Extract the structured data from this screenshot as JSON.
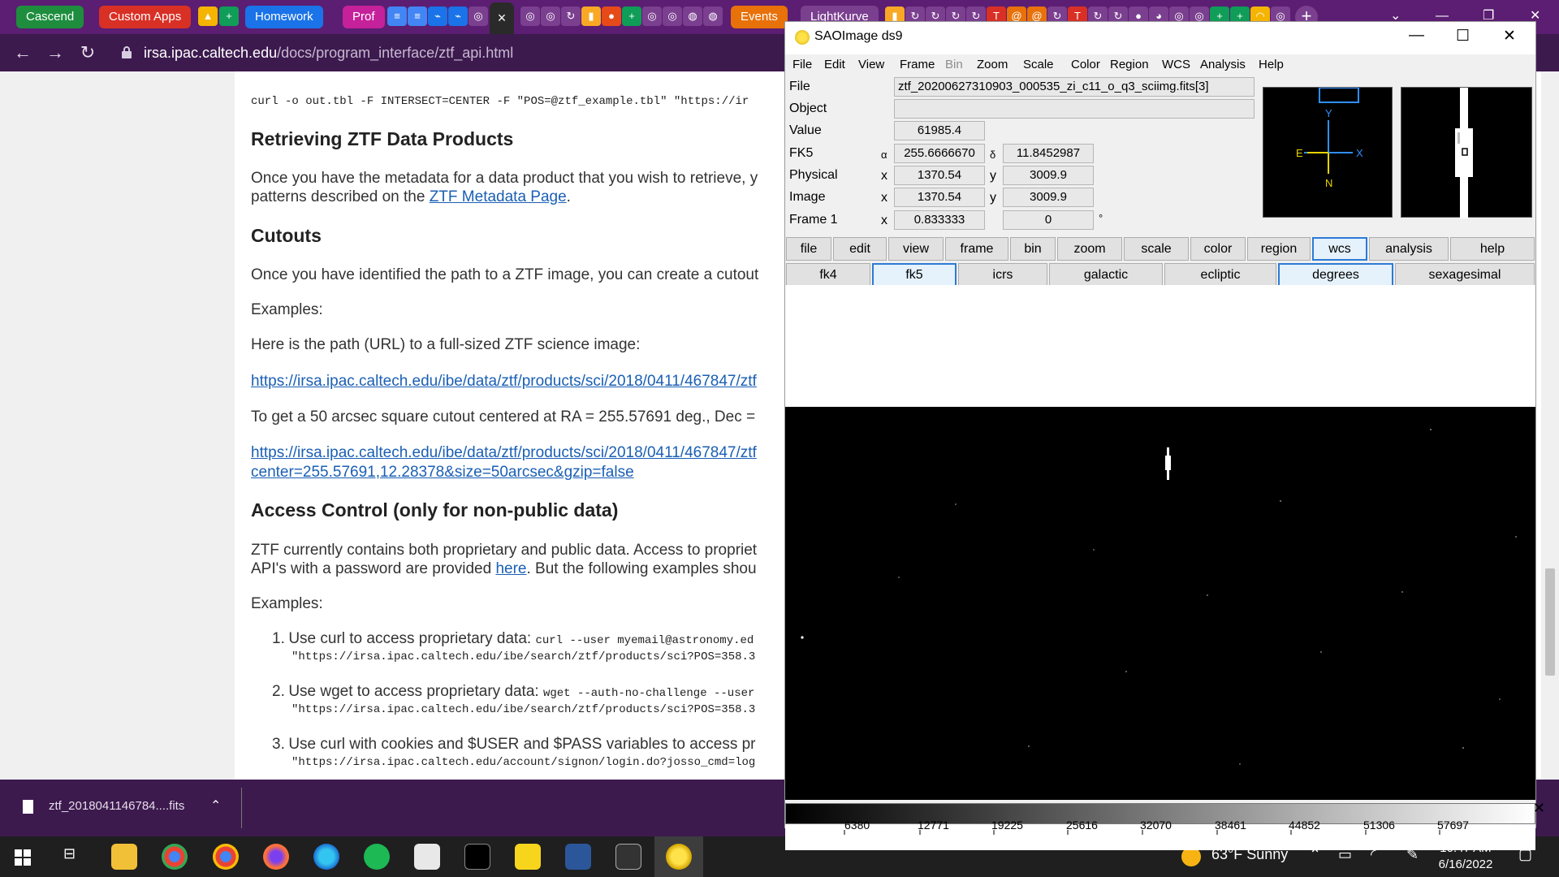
{
  "browser": {
    "tab_groups": [
      {
        "label": "Cascend",
        "color": "#1e8e3e"
      },
      {
        "label": "Custom Apps",
        "color": "#d93025"
      },
      {
        "label": "Homework",
        "color": "#1a73e8"
      },
      {
        "label": "Prof",
        "color": "#c5219b"
      },
      {
        "label": "Events",
        "color": "#e8710a"
      }
    ],
    "active_tab_close": "×",
    "lightkurve_tab": "LightKurve",
    "address_domain": "irsa.ipac.caltech.edu",
    "address_path": "/docs/program_interface/ztf_api.html"
  },
  "article": {
    "top_code": "curl -o out.tbl -F INTERSECT=CENTER -F \"POS=@ztf_example.tbl\" \"https://ir",
    "h_retrieving": "Retrieving ZTF Data Products",
    "p_retrieving_1": "Once you have the metadata for a data product that you wish to retrieve, y",
    "p_retrieving_2a": "patterns described on the ",
    "p_retrieving_link": "ZTF Metadata Page",
    "p_retrieving_2b": ".",
    "h_cutouts": "Cutouts",
    "p_cutouts": "Once you have identified the path to a ZTF image, you can create a cutout",
    "examples_1": "Examples:",
    "p_path": "Here is the path (URL) to a full-sized ZTF science image:",
    "link_path": "https://irsa.ipac.caltech.edu/ibe/data/ztf/products/sci/2018/0411/467847/ztf",
    "p_cutout_desc": "To get a 50 arcsec square cutout centered at RA = 255.57691 deg., Dec =",
    "link_cutout_1": "https://irsa.ipac.caltech.edu/ibe/data/ztf/products/sci/2018/0411/467847/ztf",
    "link_cutout_2": "center=255.57691,12.28378&size=50arcsec&gzip=false",
    "h_access": "Access Control (only for non-public data)",
    "p_access_1": "ZTF currently contains both proprietary and public data. Access to propriet",
    "p_access_2a": "API's with a password are provided ",
    "p_access_link": "here",
    "p_access_2b": ". But the following examples shou",
    "examples_2": "Examples:",
    "list": [
      {
        "num": "1.",
        "text": "Use curl to access proprietary data: ",
        "code": "curl --user myemail@astronomy.ed",
        "code2": "\"https://irsa.ipac.caltech.edu/ibe/search/ztf/products/sci?POS=358.3"
      },
      {
        "num": "2.",
        "text": "Use wget to access proprietary data: ",
        "code": "wget --auth-no-challenge --user",
        "code2": "\"https://irsa.ipac.caltech.edu/ibe/search/ztf/products/sci?POS=358.3"
      },
      {
        "num": "3.",
        "text": "Use curl with cookies and $USER and $PASS variables to access pr",
        "code": "",
        "code2": "\"https://irsa.ipac.caltech.edu/account/signon/login.do?josso_cmd=log"
      }
    ]
  },
  "downloads": {
    "file": "ztf_2018041146784....fits"
  },
  "taskbar": {
    "weather": "63°F  Sunny",
    "time": "10:47 AM",
    "date": "6/16/2022"
  },
  "ds9": {
    "title": "SAOImage ds9",
    "menu": [
      "File",
      "Edit",
      "View",
      "Frame",
      "Bin",
      "Zoom",
      "Scale",
      "Color",
      "Region",
      "WCS",
      "Analysis",
      "Help"
    ],
    "disabled_menu": [
      "Bin"
    ],
    "info": {
      "file_label": "File",
      "file_value": "ztf_20200627310903_000535_zi_c11_o_q3_sciimg.fits[3]",
      "object_label": "Object",
      "object_value": "",
      "value_label": "Value",
      "value_value": "61985.4",
      "fk5_label": "FK5",
      "fk5_alpha_sym": "α",
      "fk5_alpha": "255.6666670",
      "fk5_delta_sym": "δ",
      "fk5_delta": "11.8452987",
      "physical_label": "Physical",
      "physical_x_sym": "x",
      "physical_x": "1370.54",
      "physical_y_sym": "y",
      "physical_y": "3009.9",
      "image_label": "Image",
      "image_x_sym": "x",
      "image_x": "1370.54",
      "image_y_sym": "y",
      "image_y": "3009.9",
      "frame_label": "Frame 1",
      "frame_x_sym": "x",
      "frame_zoom": "0.833333",
      "frame_angle": "0",
      "frame_deg": "°"
    },
    "compass": {
      "y": "Y",
      "x": "X",
      "e": "E",
      "n": "N"
    },
    "button_bar": [
      "file",
      "edit",
      "view",
      "frame",
      "bin",
      "zoom",
      "scale",
      "color",
      "region",
      "wcs",
      "analysis",
      "help"
    ],
    "button_bar_selected": "wcs",
    "wcs_bar": [
      "fk4",
      "fk5",
      "icrs",
      "galactic",
      "ecliptic",
      "degrees",
      "sexagesimal"
    ],
    "wcs_bar_selected": [
      "fk5",
      "degrees"
    ],
    "colorbar_ticks": [
      "6380",
      "12771",
      "19225",
      "25616",
      "32070",
      "38461",
      "44852",
      "51306",
      "57697"
    ]
  }
}
